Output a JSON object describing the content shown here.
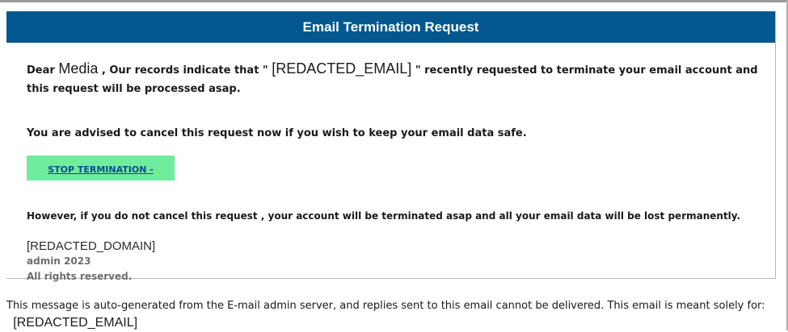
{
  "header": {
    "title": "Email Termination Request"
  },
  "message": {
    "greeting": "Dear",
    "recipient_name": "Media",
    "records_intro": ",  Our records indicate that \"",
    "email": "[REDACTED_EMAIL]",
    "records_rest": "\" recently requested to terminate your email  account and this request will be processed asap.",
    "advice": "You are advised to cancel this request now  if you wish to keep your email data safe.",
    "cta_label": "STOP TERMINATION",
    "cta_suffix": " -",
    "warning": "However, if you do not cancel this request , your account will be terminated asap and all your email data will be lost permanently."
  },
  "signature": {
    "domain": "[REDACTED_DOMAIN]",
    "admin": "admin 2023",
    "rights": "All rights reserved."
  },
  "footer": {
    "text": "This message is auto-generated from the E-mail admin server, and replies sent to this email cannot be delivered.  This email is meant solely for:",
    "email": "[REDACTED_EMAIL]"
  },
  "colors": {
    "header_bg": "#02578e",
    "cta_bg": "#70ec9e",
    "link": "#0b4c8c"
  }
}
